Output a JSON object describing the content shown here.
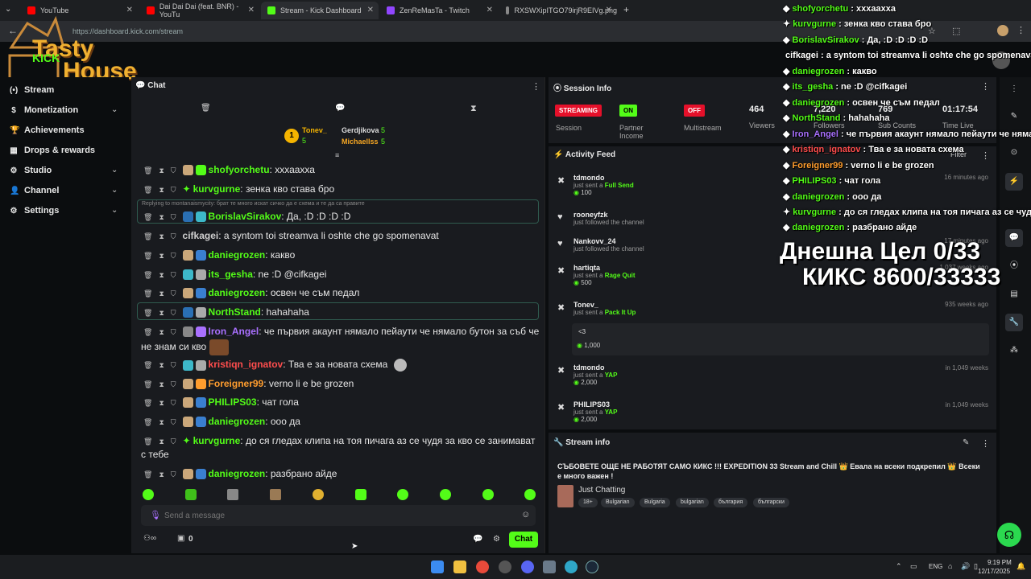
{
  "browser": {
    "tabs": [
      {
        "label": "YouTube",
        "color": "#ff0000"
      },
      {
        "label": "Dai Dai Dai (feat. BNR) - YouTu",
        "color": "#ff0000"
      },
      {
        "label": "Stream - Kick Dashboard",
        "color": "#53fc18"
      },
      {
        "label": "ZenReMasTa - Twitch",
        "color": "#9146ff"
      },
      {
        "label": "RXSWXipITGO79irjR9EIVg.png",
        "color": "#888888"
      }
    ],
    "url": "https://dashboard.kick.com/stream"
  },
  "logo": {
    "line1": "Tasty",
    "line2": "House",
    "kick": "KICK"
  },
  "nav": [
    {
      "label": "Stream",
      "icon": "(•)"
    },
    {
      "label": "Monetization",
      "icon": "$"
    },
    {
      "label": "Achievements",
      "icon": "🏆"
    },
    {
      "label": "Drops & rewards",
      "icon": "▦"
    },
    {
      "label": "Studio",
      "icon": "⚙"
    },
    {
      "label": "Channel",
      "icon": "👤"
    },
    {
      "label": "Settings",
      "icon": "⚙"
    }
  ],
  "chat": {
    "title": "Chat",
    "leaders": {
      "rank": "1",
      "first": "Tonev_",
      "first_count": "5",
      "second": "Gerdjikova",
      "second_count": "5",
      "third": "Michaellss",
      "third_count": "5"
    },
    "messages": [
      {
        "user": "shofyorchetu",
        "text": ": хххаахха",
        "color": "#53fc18"
      },
      {
        "user": "kurvgurne",
        "text": ": зенка кво става бро",
        "color": "#53fc18"
      },
      {
        "reply": "Replying to montanaismycity: брат те много искат сичко да е схема и те да са правите",
        "user": "BorislavSirakov",
        "text": ": Да, :D :D :D :D",
        "color": "#53fc18"
      },
      {
        "user": "cifkagei",
        "text": ": a syntom toi streamva li oshte che go spomenavat",
        "color": "#cfcfcf"
      },
      {
        "user": "daniegrozen",
        "text": ": какво",
        "color": "#53fc18"
      },
      {
        "user": "its_gesha",
        "text": ": ne :D @cifkagei",
        "color": "#53fc18"
      },
      {
        "user": "daniegrozen",
        "text": ": освен че съм педал",
        "color": "#53fc18"
      },
      {
        "user": "NorthStand",
        "text": ": hahahaha",
        "color": "#53fc18"
      },
      {
        "user": "Iron_Angel",
        "text": ": че първия акаунт нямало пейаути че нямало бутон за съб че",
        "cont": "не знам си кво",
        "color": "#a970ff"
      },
      {
        "user": "kristiqn_ignatov",
        "text": ": Тва е за новата схема",
        "color": "#ff4d4d"
      },
      {
        "user": "Foreigner99",
        "text": ": verno li e be grozen",
        "color": "#ff9d2e"
      },
      {
        "user": "PHILIPS03",
        "text": ": чат гола",
        "color": "#53fc18"
      },
      {
        "user": "daniegrozen",
        "text": ": ооо да",
        "color": "#53fc18"
      },
      {
        "user": "kurvgurne",
        "text": ": до ся гледах клипа на тоя пичага аз се чудя за кво се занимават",
        "cont": "с тебе",
        "color": "#53fc18"
      },
      {
        "user": "daniegrozen",
        "text": ": разбрано айде",
        "color": "#53fc18"
      }
    ],
    "placeholder": "Send a message",
    "bottom_count": "0",
    "chat_button": "Chat"
  },
  "session": {
    "title": "Session Info",
    "streaming": "STREAMING",
    "streaming_label": "Session",
    "partner": "ON",
    "partner_label": "Partner Income",
    "multistream": "OFF",
    "multistream_label": "Multistream",
    "viewers": "464",
    "viewers_label": "Viewers",
    "followers": "7,220",
    "followers_label": "Followers",
    "subs": "769",
    "subs_label": "Sub Counts",
    "time": "01:17:54",
    "time_label": "Time Live"
  },
  "activity": {
    "title": "Activity Feed",
    "filter": "Filter",
    "items": [
      {
        "name": "tdmondo",
        "pre": "just sent a",
        "what": "Full Send",
        "amount": "100",
        "ago": ""
      },
      {
        "name": "rooneyfzk",
        "pre": "just followed the channel",
        "what": "",
        "amount": "",
        "ago": "16 minutes ago"
      },
      {
        "name": "Nankovv_24",
        "pre": "just followed the channel",
        "what": "",
        "amount": "",
        "ago": "17 minutes ago"
      },
      {
        "name": "hartiqta",
        "pre": "just sent a",
        "what": "Rage Quit",
        "amount": "500",
        "ago": "1,037 weeks ago"
      },
      {
        "name": "Tonev_",
        "pre": "just sent a",
        "what": "Pack It Up",
        "amount": "1,000",
        "ago": "935 weeks ago",
        "note": "<3"
      },
      {
        "name": "tdmondo",
        "pre": "just sent a",
        "what": "YAP",
        "amount": "2,000",
        "ago": "in 1,049 weeks"
      },
      {
        "name": "PHILIPS03",
        "pre": "just sent a",
        "what": "YAP",
        "amount": "2,000",
        "ago": "in 1,049 weeks"
      }
    ]
  },
  "stream_info": {
    "title": "Stream info",
    "stream_title": "СЪБОВЕТЕ ОЩЕ НЕ РАБОТЯТ САМО КИКС !!! EXPEDITION 33 Stream and Chill 👑 Евала на всеки подкрепил 👑 Всеки е много важен !",
    "category": "Just Chatting",
    "tags": [
      "18+",
      "Bulgarian",
      "Bulgaria",
      "bulgarian",
      "българия",
      "български"
    ]
  },
  "overlay": {
    "chat": [
      {
        "user": "shofyorchetu",
        "text": " : хххаахха"
      },
      {
        "user": "kurvgurne",
        "text": " : зенка кво става бро"
      },
      {
        "user": "BorislavSirakov",
        "text": " : Да, :D :D :D :D"
      },
      {
        "user": "cifkagei",
        "text": " : a syntom toi streamva li oshte che go spomenavat"
      },
      {
        "user": "daniegrozen",
        "text": " : какво"
      },
      {
        "user": "its_gesha",
        "text": " : ne :D @cifkagei"
      },
      {
        "user": "daniegrozen",
        "text": " : освен че съм педал"
      },
      {
        "user": "NorthStand",
        "text": " : hahahaha"
      },
      {
        "user": "Iron_Angel",
        "text": " : че първия акаунт нямало пейаути че нямало"
      },
      {
        "user": "kristiqn_ignatov",
        "text": " : Тва е за новата схема"
      },
      {
        "user": "Foreigner99",
        "text": " : verno li e be grozen"
      },
      {
        "user": "PHILIPS03",
        "text": " : чат гола"
      },
      {
        "user": "daniegrozen",
        "text": " : ооо да"
      },
      {
        "user": "kurvgurne",
        "text": " : до ся гледах клипа на тоя пичага аз се чудя за к"
      },
      {
        "user": "daniegrozen",
        "text": " : разбрано айде"
      }
    ],
    "goal_line1": "Днешна Цел 0/33",
    "goal_line2": "КИКС 8600/33333"
  },
  "taskbar": {
    "lang": "ENG",
    "time": "9:19 PM",
    "date": "12/17/2025"
  },
  "colors": {
    "accent": "#53fc18",
    "panel": "#191b1f",
    "bg": "#0b0d0f"
  }
}
